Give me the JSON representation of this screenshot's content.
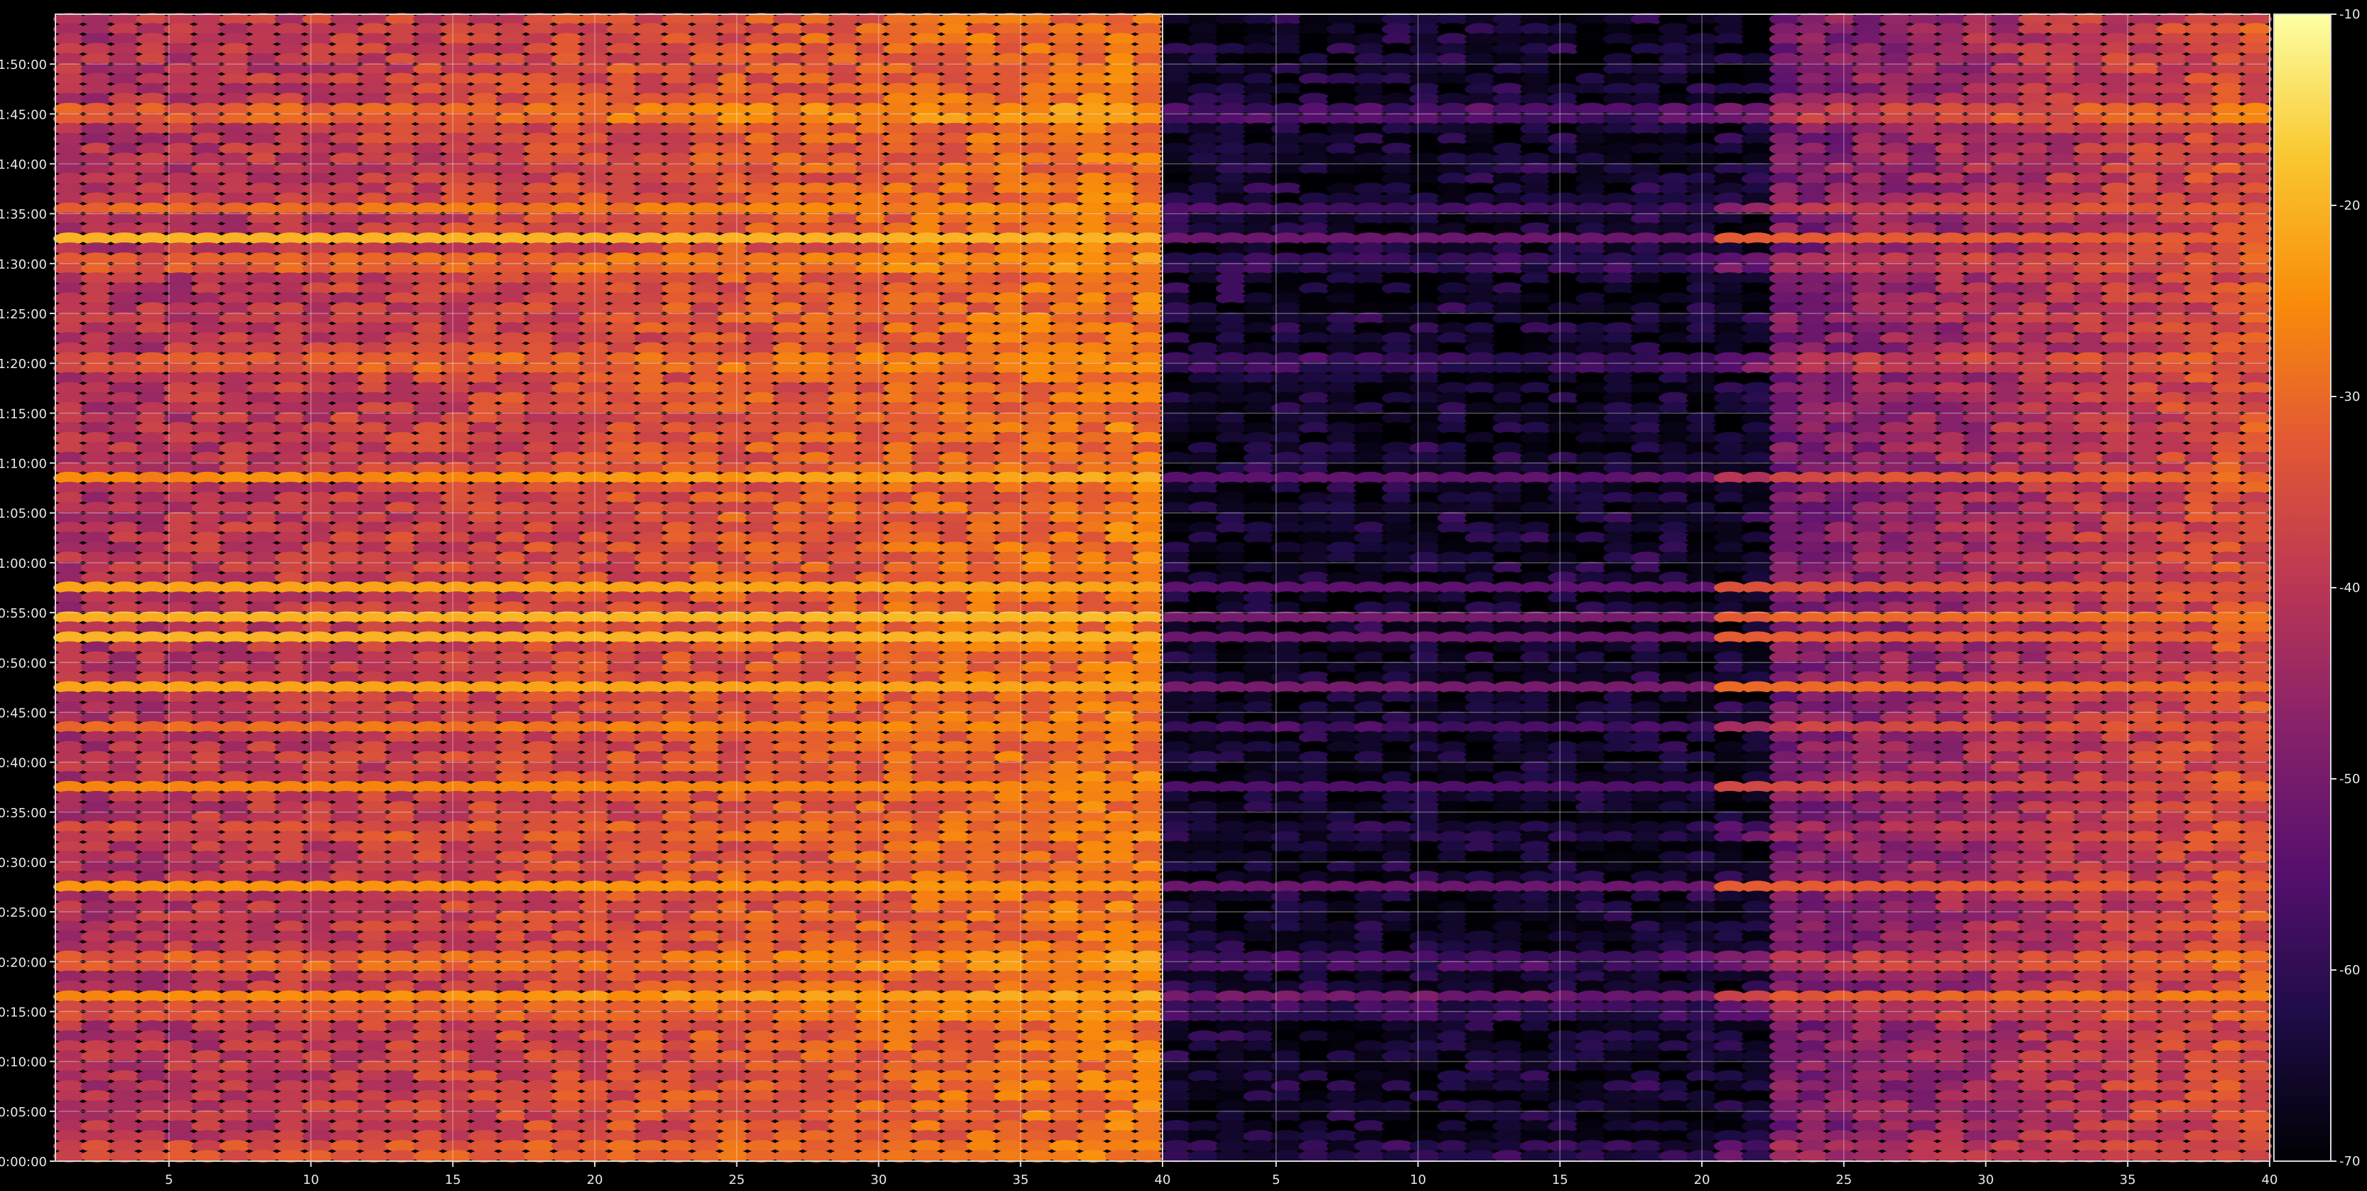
{
  "chart_data": {
    "type": "heatmap",
    "title": "",
    "colormap": "inferno",
    "background": "#000000",
    "grid": true,
    "colorbar": {
      "location": "right",
      "min": -70,
      "max": -10,
      "ticks": [
        -10,
        -20,
        -30,
        -40,
        -50,
        -60,
        -70
      ]
    },
    "yaxis": {
      "label": "",
      "min_seconds": 0,
      "max_seconds": 6900,
      "ticks": [
        {
          "seconds": 0,
          "label": "0:00:00"
        },
        {
          "seconds": 300,
          "label": "0:05:00"
        },
        {
          "seconds": 600,
          "label": "0:10:00"
        },
        {
          "seconds": 900,
          "label": "0:15:00"
        },
        {
          "seconds": 1200,
          "label": "0:20:00"
        },
        {
          "seconds": 1500,
          "label": "0:25:00"
        },
        {
          "seconds": 1800,
          "label": "0:30:00"
        },
        {
          "seconds": 2100,
          "label": "0:35:00"
        },
        {
          "seconds": 2400,
          "label": "0:40:00"
        },
        {
          "seconds": 2700,
          "label": "0:45:00"
        },
        {
          "seconds": 3000,
          "label": "0:50:00"
        },
        {
          "seconds": 3300,
          "label": "0:55:00"
        },
        {
          "seconds": 3600,
          "label": "1:00:00"
        },
        {
          "seconds": 3900,
          "label": "1:05:00"
        },
        {
          "seconds": 4200,
          "label": "1:10:00"
        },
        {
          "seconds": 4500,
          "label": "1:15:00"
        },
        {
          "seconds": 4800,
          "label": "1:20:00"
        },
        {
          "seconds": 5100,
          "label": "1:25:00"
        },
        {
          "seconds": 5400,
          "label": "1:30:00"
        },
        {
          "seconds": 5700,
          "label": "1:35:00"
        },
        {
          "seconds": 6000,
          "label": "1:40:00"
        },
        {
          "seconds": 6300,
          "label": "1:45:00"
        },
        {
          "seconds": 6600,
          "label": "1:50:00"
        }
      ]
    },
    "panels": [
      {
        "name": "",
        "xlim": [
          1,
          40
        ],
        "xticks": [
          "5",
          "10",
          "15",
          "20",
          "25",
          "30",
          "35",
          "40"
        ],
        "xtick_values": [
          5,
          10,
          15,
          20,
          25,
          30,
          35,
          40
        ],
        "channels": [
          1,
          40
        ],
        "level_left": -42,
        "level_right": -28
      },
      {
        "name": "",
        "xlim": [
          1,
          40
        ],
        "xticks": [
          "5",
          "10",
          "15",
          "20",
          "25",
          "30",
          "35",
          "40"
        ],
        "xtick_values": [
          5,
          10,
          15,
          20,
          25,
          30,
          35,
          40
        ],
        "channels": [
          1,
          40
        ],
        "level_left": -70,
        "level_right": -34
      }
    ],
    "bands": [
      {
        "time": 6300,
        "level": -14,
        "right_panel": -24
      },
      {
        "time": 5400,
        "level": -18,
        "right_panel": -34
      },
      {
        "time": 5550,
        "level": -20,
        "right_panel": -38
      },
      {
        "time": 5750,
        "level": -22,
        "right_panel": -36
      },
      {
        "time": 4800,
        "level": -20,
        "right_panel": -32
      },
      {
        "time": 4125,
        "level": -18,
        "right_panel": -34
      },
      {
        "time": 3450,
        "level": -22,
        "right_panel": -40
      },
      {
        "time": 3275,
        "level": -18,
        "right_panel": -34
      },
      {
        "time": 3150,
        "level": -20,
        "right_panel": -38
      },
      {
        "time": 2850,
        "level": -22,
        "right_panel": -36
      },
      {
        "time": 2625,
        "level": -24,
        "right_panel": -38
      },
      {
        "time": 2250,
        "level": -26,
        "right_panel": -42
      },
      {
        "time": 1980,
        "level": -26,
        "right_panel": -42
      },
      {
        "time": 1650,
        "level": -24,
        "right_panel": -38
      },
      {
        "time": 1200,
        "level": -16,
        "right_panel": -28
      },
      {
        "time": 975,
        "level": -18,
        "right_panel": -30
      },
      {
        "time": 900,
        "level": -20,
        "right_panel": -34
      },
      {
        "time": 60,
        "level": -24,
        "right_panel": -40
      }
    ]
  }
}
